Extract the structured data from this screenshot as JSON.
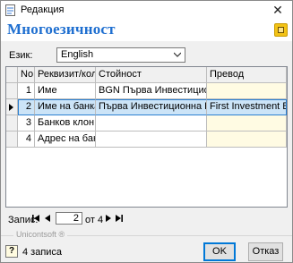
{
  "window": {
    "title": "Редакция"
  },
  "header": {
    "heading": "Многоезичност"
  },
  "language": {
    "label": "Език:",
    "selected": "English"
  },
  "grid": {
    "columns": [
      "No.",
      "Реквизит/колона",
      "Стойност",
      "Превод"
    ],
    "rows": [
      {
        "no": "1",
        "field": "Име",
        "value": "BGN Първа Инвестиционна",
        "translation": ""
      },
      {
        "no": "2",
        "field": "Име на банка",
        "value": "Първа Инвестиционна Банка",
        "translation": "First Investment Bank"
      },
      {
        "no": "3",
        "field": "Банков клон",
        "value": "",
        "translation": ""
      },
      {
        "no": "4",
        "field": "Адрес на банка",
        "value": "",
        "translation": ""
      }
    ]
  },
  "navigator": {
    "label": "Запис:",
    "current": "2",
    "of_text": "от 4"
  },
  "footer": {
    "brand": "Unicontsoft ®",
    "status": "4 записа",
    "ok_label": "OK",
    "cancel_label": "Отказ"
  },
  "colors": {
    "accent": "#1f6fd0",
    "selection": "#cce4f7",
    "translation_bg": "#fffbe3"
  }
}
